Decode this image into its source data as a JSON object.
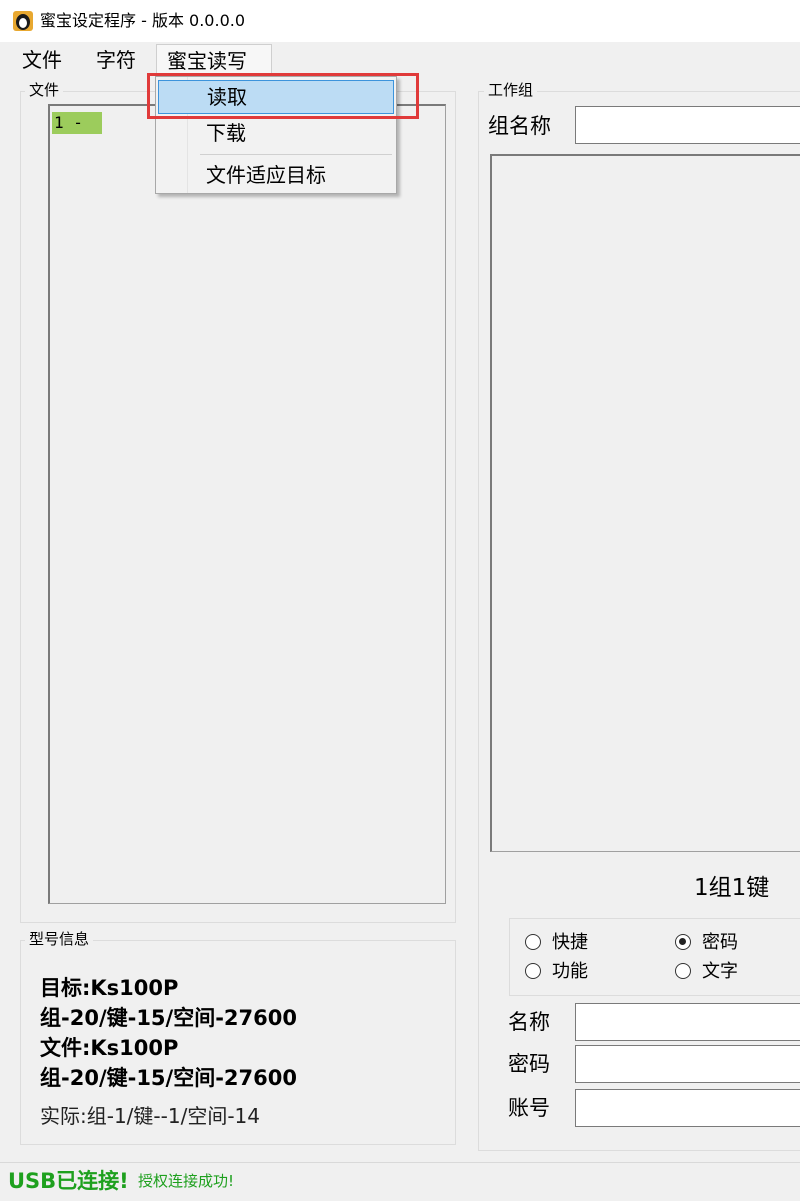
{
  "window": {
    "title": "蜜宝设定程序 - 版本 0.0.0.0"
  },
  "menubar": {
    "items": [
      "文件",
      "字符",
      "蜜宝读写"
    ]
  },
  "dropdown": {
    "items": [
      "读取",
      "下载",
      "文件适应目标"
    ]
  },
  "file_panel": {
    "title": "文件",
    "items": [
      "1 -"
    ]
  },
  "model_info": {
    "title": "型号信息",
    "target": "目标:Ks100P",
    "target_spec": "组-20/键-15/空间-27600",
    "file": "文件:Ks100P",
    "file_spec": "组-20/键-15/空间-27600",
    "actual": "实际:组-1/键--1/空间-14"
  },
  "work_group": {
    "title": "工作组",
    "group_name_label": "组名称",
    "group_name_value": "",
    "key_position": "1组1键",
    "key_type": {
      "options": [
        "快捷",
        "密码",
        "功能",
        "文字"
      ],
      "selected": "密码"
    },
    "fields": {
      "name_label": "名称",
      "password_label": "密码",
      "account_label": "账号"
    }
  },
  "status": {
    "usb": "USB已连接!",
    "auth": "授权连接成功!"
  },
  "colors": {
    "status_green": "#1ea01e",
    "list_item_highlight": "#9ccc5c",
    "menu_selection": "#bcdcf4",
    "annotation_red": "#e03a3a"
  }
}
